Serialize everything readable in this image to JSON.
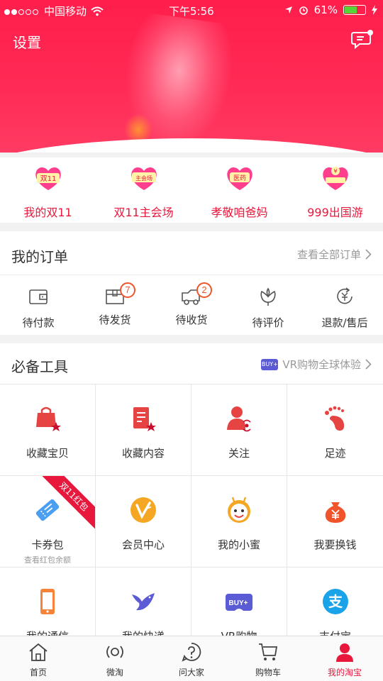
{
  "status_bar": {
    "carrier": "中国移动",
    "time": "下午5:56",
    "battery": "61%",
    "battery_level": 0.61
  },
  "header": {
    "settings_label": "设置"
  },
  "promos": [
    {
      "label": "我的双11",
      "icon": "double11-icon",
      "icon_text": "双11"
    },
    {
      "label": "双11主会场",
      "icon": "main-venue-icon",
      "icon_text": "主会场"
    },
    {
      "label": "孝敬咱爸妈",
      "icon": "medicine-icon",
      "icon_text": "医药"
    },
    {
      "label": "999出国游",
      "icon": "travel-icon",
      "icon_text": "¥"
    }
  ],
  "orders": {
    "title": "我的订单",
    "view_all": "查看全部订单",
    "items": [
      {
        "label": "待付款",
        "icon": "wallet-icon",
        "badge": ""
      },
      {
        "label": "待发货",
        "icon": "package-icon",
        "badge": "7"
      },
      {
        "label": "待收货",
        "icon": "truck-icon",
        "badge": "2"
      },
      {
        "label": "待评价",
        "icon": "flower-icon",
        "badge": ""
      },
      {
        "label": "退款/售后",
        "icon": "refund-icon",
        "badge": ""
      }
    ]
  },
  "tools": {
    "title": "必备工具",
    "vr_link": "VR购物全球体验",
    "vr_badge": "BUY+",
    "items": [
      {
        "label": "收藏宝贝",
        "icon": "favorite-bag-icon",
        "sub": ""
      },
      {
        "label": "收藏内容",
        "icon": "favorite-content-icon",
        "sub": ""
      },
      {
        "label": "关注",
        "icon": "follow-icon",
        "sub": ""
      },
      {
        "label": "足迹",
        "icon": "footprint-icon",
        "sub": ""
      },
      {
        "label": "卡券包",
        "icon": "coupon-icon",
        "sub": "查看红包余额",
        "ribbon": "双11红包"
      },
      {
        "label": "会员中心",
        "icon": "vip-icon",
        "sub": ""
      },
      {
        "label": "我的小蜜",
        "icon": "assistant-icon",
        "sub": ""
      },
      {
        "label": "我要换钱",
        "icon": "money-bag-icon",
        "sub": ""
      },
      {
        "label": "我的通信",
        "icon": "phone-icon",
        "sub": ""
      },
      {
        "label": "我的快递",
        "icon": "courier-bird-icon",
        "sub": ""
      },
      {
        "label": "VR购物",
        "icon": "vr-buy-icon",
        "sub": "",
        "icon_text": "BUY+"
      },
      {
        "label": "支付宝",
        "icon": "alipay-icon",
        "sub": "",
        "icon_text": "支"
      }
    ]
  },
  "tabbar": [
    {
      "label": "首页",
      "icon": "home-icon"
    },
    {
      "label": "微淘",
      "icon": "broadcast-icon"
    },
    {
      "label": "问大家",
      "icon": "question-icon"
    },
    {
      "label": "购物车",
      "icon": "cart-icon"
    },
    {
      "label": "我的淘宝",
      "icon": "profile-icon",
      "active": true
    }
  ],
  "colors": {
    "brand_red": "#e8173c",
    "badge_orange": "#f0542a",
    "vr_purple": "#5b5bd6",
    "alipay_blue": "#1aa3e8"
  }
}
